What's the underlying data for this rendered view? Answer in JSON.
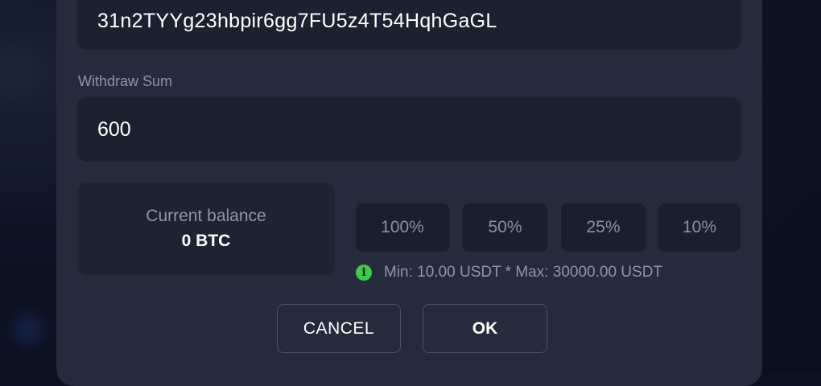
{
  "withdraw_form": {
    "address": {
      "value": "31n2TYYg23hbpir6gg7FU5z4T54HqhGaGL"
    },
    "sum": {
      "label": "Withdraw Sum",
      "value": "600"
    },
    "balance": {
      "label": "Current balance",
      "value": "0 BTC"
    },
    "percent_buttons": [
      {
        "label": "100%"
      },
      {
        "label": "50%"
      },
      {
        "label": "25%"
      },
      {
        "label": "10%"
      }
    ],
    "limits": {
      "icon": "info-icon",
      "text": "Min: 10.00 USDT * Max: 30000.00 USDT"
    },
    "actions": {
      "cancel_label": "CANCEL",
      "ok_label": "OK"
    }
  },
  "colors": {
    "modal_bg": "#262b3b",
    "field_bg": "#1c2130",
    "info_green": "#3ccb4a",
    "muted_text": "#8e95a6"
  }
}
